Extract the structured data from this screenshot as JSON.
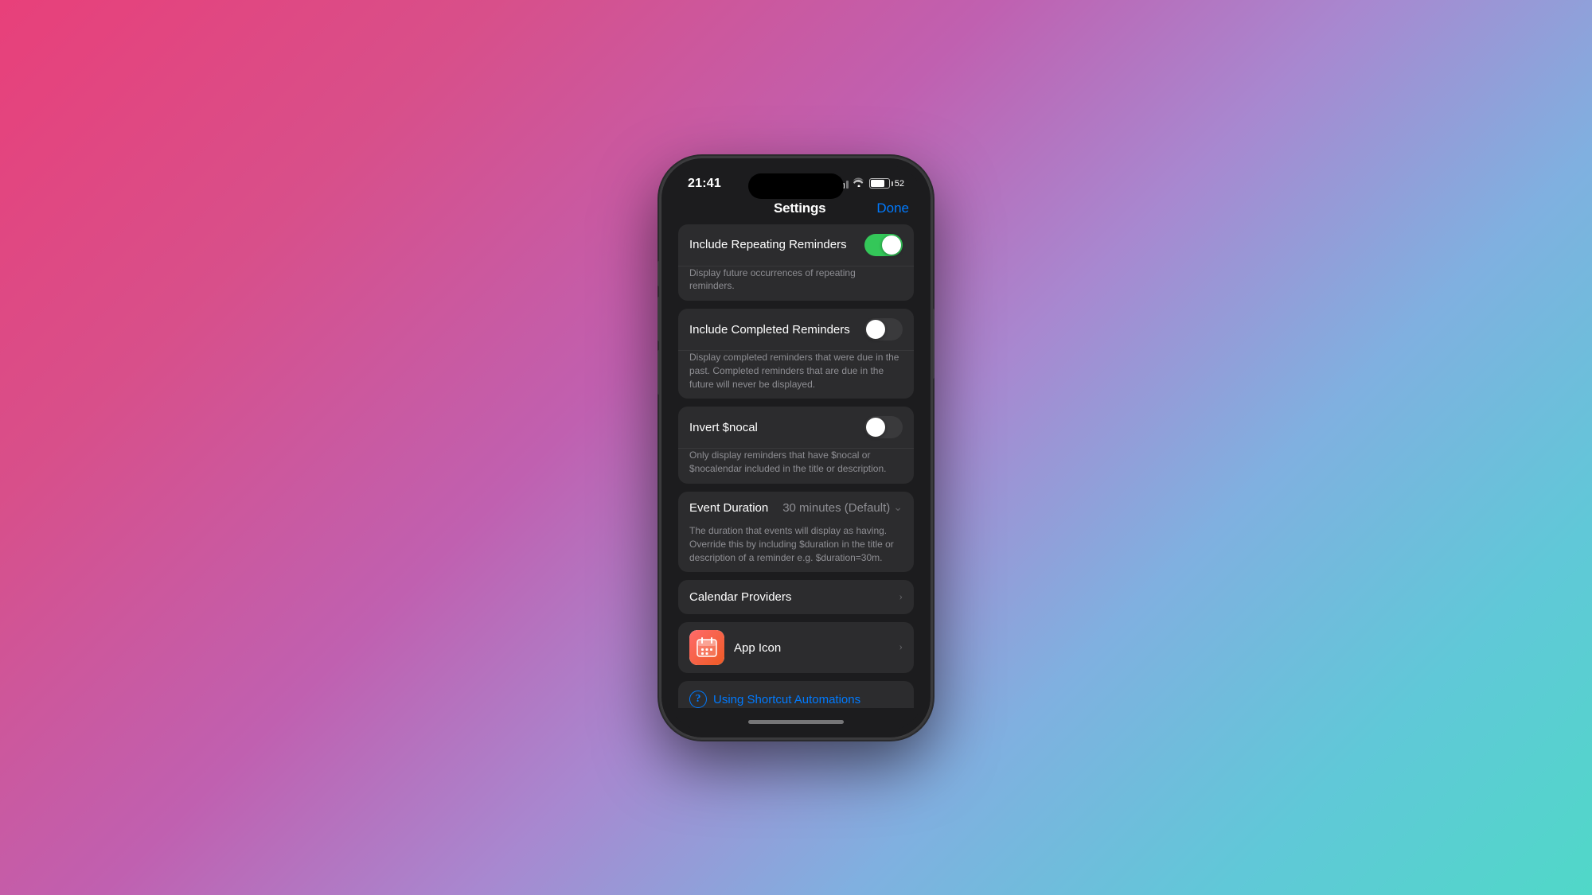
{
  "status_bar": {
    "time": "21:41",
    "battery_percent": "52"
  },
  "nav": {
    "title": "Settings",
    "done_label": "Done"
  },
  "settings": {
    "repeating_reminders": {
      "label": "Include Repeating Reminders",
      "enabled": true,
      "description": "Display future occurrences of repeating reminders."
    },
    "completed_reminders": {
      "label": "Include Completed Reminders",
      "enabled": false,
      "description": "Display completed reminders that were due in the past. Completed reminders that are due in the future will never be displayed."
    },
    "invert_nocal": {
      "label": "Invert $nocal",
      "enabled": false,
      "description": "Only display reminders that have $nocal or $nocalendar included in the title or description."
    },
    "event_duration": {
      "label": "Event Duration",
      "value": "30 minutes (Default)"
    },
    "event_duration_description": "The duration that events will display as having. Override this by including $duration in the title or description of a reminder e.g. $duration=30m.",
    "calendar_providers": {
      "label": "Calendar Providers"
    },
    "app_icon": {
      "label": "App Icon"
    },
    "shortcut": {
      "label": "Using Shortcut Automations"
    }
  }
}
